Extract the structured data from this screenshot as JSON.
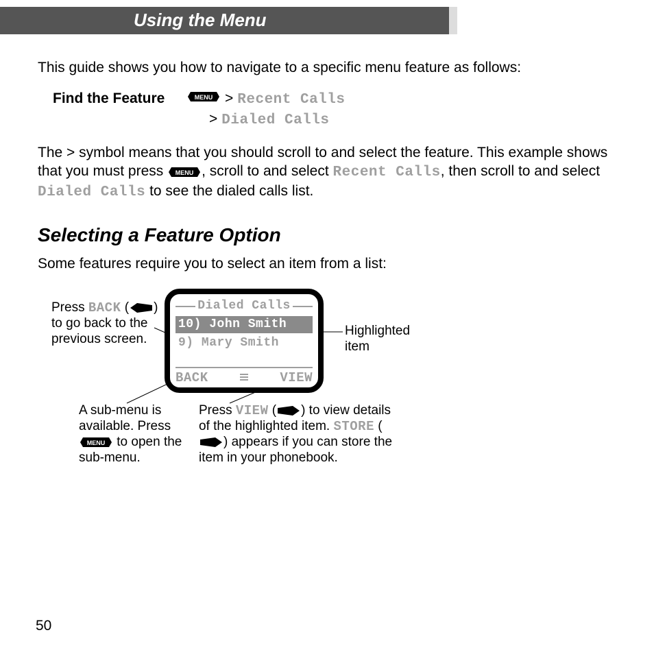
{
  "header": {
    "title": "Using the Menu"
  },
  "intro": "This guide shows you how to navigate to a specific menu feature as follows:",
  "find": {
    "label": "Find the Feature",
    "sep": ">",
    "path1": "Recent Calls",
    "path2": "Dialed Calls"
  },
  "para2": {
    "pre": "The > symbol means that you should scroll to and select the feature. This example shows that you must press ",
    "key": "MENU",
    "mid1": ", scroll to and select ",
    "rc": "Recent Calls",
    "mid2": ", then scroll to and select ",
    "dc": "Dialed Calls",
    "end": " to see the dialed calls list."
  },
  "section": "Selecting a Feature Option",
  "para3": "Some features require you to select an item from a list:",
  "screen": {
    "title": "Dialed Calls",
    "items": [
      {
        "idx": "10)",
        "name": "John Smith"
      },
      {
        "idx": "9)",
        "name": "Mary Smith"
      }
    ],
    "soft_left": "BACK",
    "soft_right": "VIEW"
  },
  "callouts": {
    "left1": "Press ",
    "left_back": "BACK",
    "left2": " (",
    "left3": ") to go back to the previous screen.",
    "right": "Highlighted item",
    "bl1": "A sub-menu is available. Press ",
    "bl2": " to open the sub-menu.",
    "br1": "Press ",
    "br_view": "VIEW",
    "br2": " (",
    "br3": ") to view details of the highlighted item. ",
    "br_store": "STORE",
    "br4": " (",
    "br5": ") appears if you can store the item in your phonebook."
  },
  "page_number": "50"
}
